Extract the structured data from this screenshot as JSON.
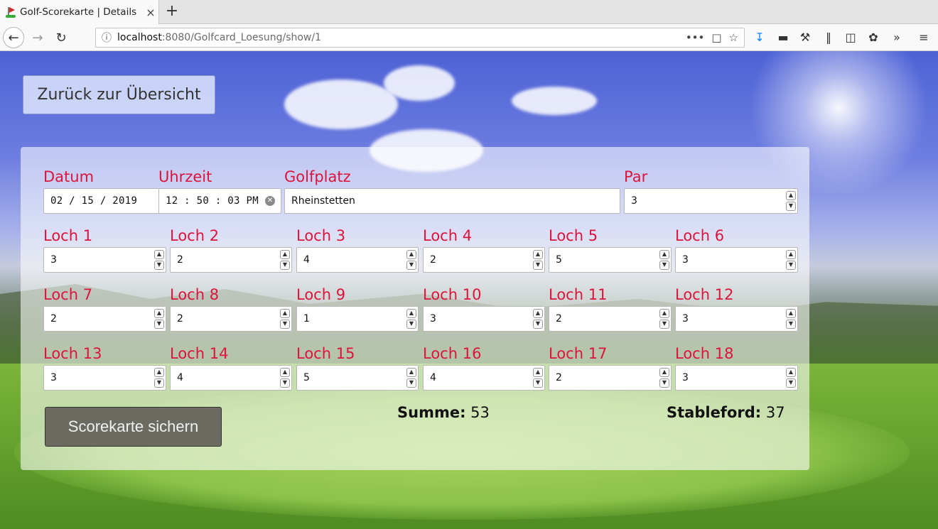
{
  "browser": {
    "tab_title": "Golf-Scorekarte | Details",
    "tab_close": "×",
    "new_tab": "+",
    "url_host": "localhost",
    "url_rest": ":8080/Golfcard_Loesung/show/1",
    "url_more": "•••"
  },
  "nav": {
    "back_label": "Zurück zur Übersicht"
  },
  "header_fields": {
    "date_label": "Datum",
    "date_value": "02 / 15 / 2019",
    "time_label": "Uhrzeit",
    "time_value": "12 : 50 : 03   PM",
    "course_label": "Golfplatz",
    "course_value": "Rheinstetten",
    "par_label": "Par",
    "par_value": "3"
  },
  "holes": [
    {
      "label": "Loch 1",
      "value": "3"
    },
    {
      "label": "Loch 2",
      "value": "2"
    },
    {
      "label": "Loch 3",
      "value": "4"
    },
    {
      "label": "Loch 4",
      "value": "2"
    },
    {
      "label": "Loch 5",
      "value": "5"
    },
    {
      "label": "Loch 6",
      "value": "3"
    },
    {
      "label": "Loch 7",
      "value": "2"
    },
    {
      "label": "Loch 8",
      "value": "2"
    },
    {
      "label": "Loch 9",
      "value": "1"
    },
    {
      "label": "Loch 10",
      "value": "3"
    },
    {
      "label": "Loch 11",
      "value": "2"
    },
    {
      "label": "Loch 12",
      "value": "3"
    },
    {
      "label": "Loch 13",
      "value": "3"
    },
    {
      "label": "Loch 14",
      "value": "4"
    },
    {
      "label": "Loch 15",
      "value": "5"
    },
    {
      "label": "Loch 16",
      "value": "4"
    },
    {
      "label": "Loch 17",
      "value": "2"
    },
    {
      "label": "Loch 18",
      "value": "3"
    }
  ],
  "summary": {
    "save_label": "Scorekarte sichern",
    "sum_label": "Summe:",
    "sum_value": "53",
    "stableford_label": "Stableford:",
    "stableford_value": "37"
  }
}
